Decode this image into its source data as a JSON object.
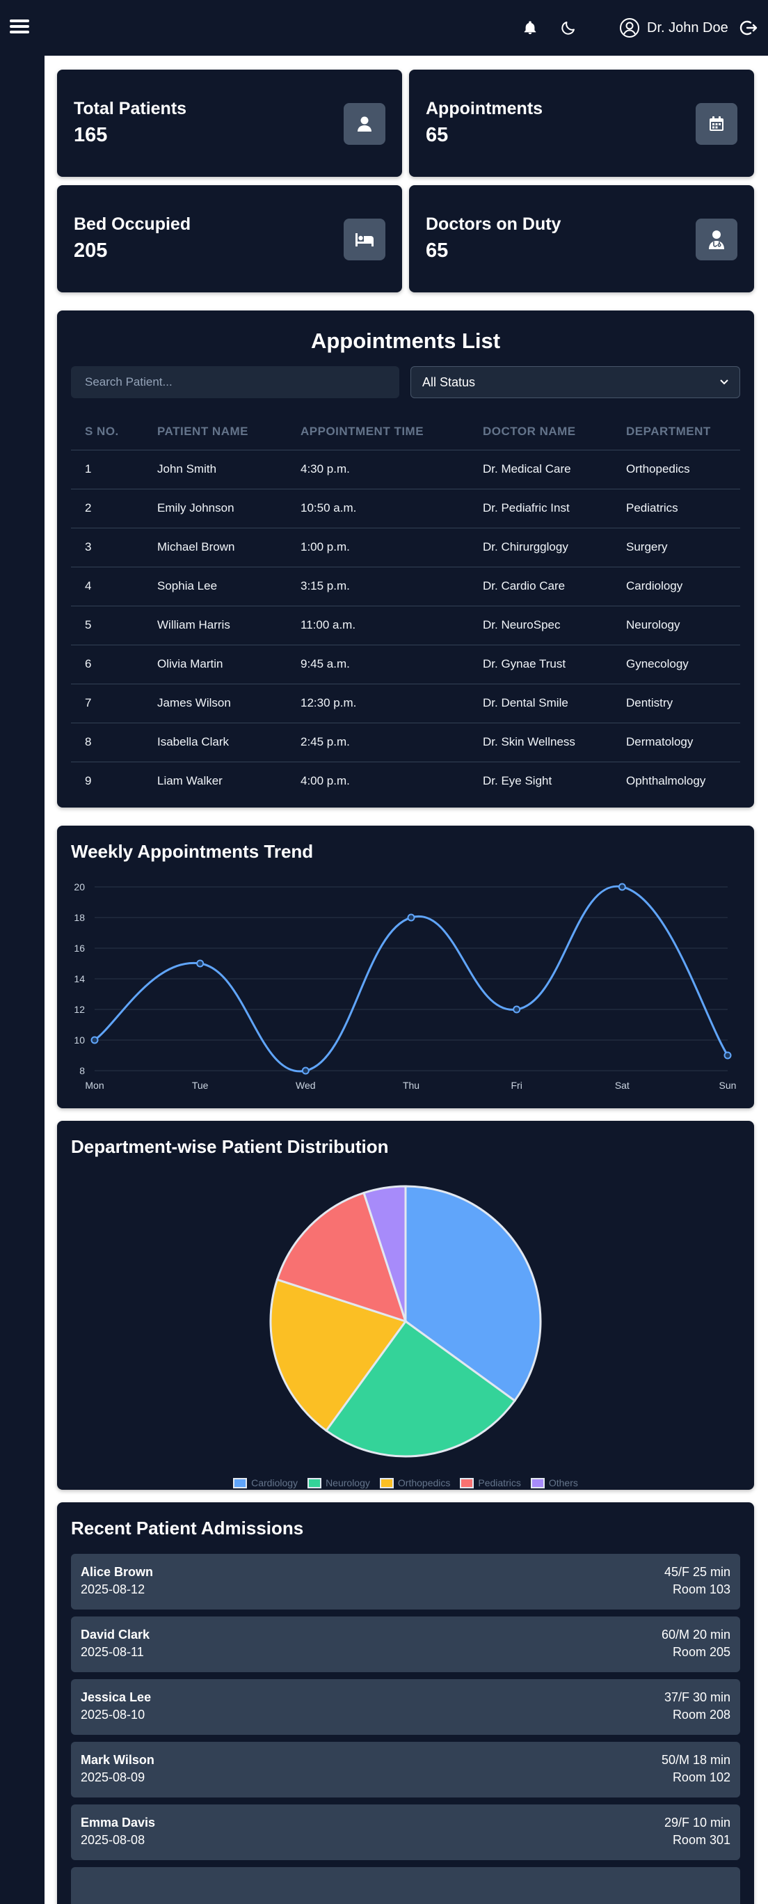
{
  "header": {
    "user_name": "Dr. John Doe",
    "icons": [
      "menu-icon",
      "bell-icon",
      "moon-icon",
      "user-circle-icon",
      "logout-icon"
    ]
  },
  "stats": [
    {
      "label": "Total Patients",
      "value": "165",
      "icon": "user-icon"
    },
    {
      "label": "Appointments",
      "value": "65",
      "icon": "calendar-icon"
    },
    {
      "label": "Bed Occupied",
      "value": "205",
      "icon": "bed-icon"
    },
    {
      "label": "Doctors on Duty",
      "value": "65",
      "icon": "doctor-icon"
    }
  ],
  "appointments": {
    "title": "Appointments List",
    "search_placeholder": "Search Patient...",
    "status_filter": "All Status",
    "columns": [
      "S NO.",
      "PATIENT NAME",
      "APPOINTMENT TIME",
      "DOCTOR NAME",
      "DEPARTMENT"
    ],
    "rows": [
      [
        "1",
        "John Smith",
        "4:30 p.m.",
        "Dr. Medical Care",
        "Orthopedics"
      ],
      [
        "2",
        "Emily Johnson",
        "10:50 a.m.",
        "Dr. Pediafric Inst",
        "Pediatrics"
      ],
      [
        "3",
        "Michael Brown",
        "1:00 p.m.",
        "Dr. Chirurgglogy",
        "Surgery"
      ],
      [
        "4",
        "Sophia Lee",
        "3:15 p.m.",
        "Dr. Cardio Care",
        "Cardiology"
      ],
      [
        "5",
        "William Harris",
        "11:00 a.m.",
        "Dr. NeuroSpec",
        "Neurology"
      ],
      [
        "6",
        "Olivia Martin",
        "9:45 a.m.",
        "Dr. Gynae Trust",
        "Gynecology"
      ],
      [
        "7",
        "James Wilson",
        "12:30 p.m.",
        "Dr. Dental Smile",
        "Dentistry"
      ],
      [
        "8",
        "Isabella Clark",
        "2:45 p.m.",
        "Dr. Skin Wellness",
        "Dermatology"
      ],
      [
        "9",
        "Liam Walker",
        "4:00 p.m.",
        "Dr. Eye Sight",
        "Ophthalmology"
      ]
    ]
  },
  "weekly_trend": {
    "title": "Weekly Appointments Trend",
    "chart_data": {
      "type": "line",
      "x": [
        "Mon",
        "Tue",
        "Wed",
        "Thu",
        "Fri",
        "Sat",
        "Sun"
      ],
      "series": [
        {
          "values": [
            10,
            15,
            8,
            18,
            12,
            20,
            9
          ],
          "color": "#60a5fa"
        }
      ],
      "yticks": [
        8,
        10,
        12,
        14,
        16,
        18,
        20
      ],
      "ylim": [
        8,
        20
      ],
      "grid": true
    }
  },
  "department_distribution": {
    "title": "Department-wise Patient Distribution",
    "chart_data": {
      "type": "pie",
      "labels": [
        "Cardiology",
        "Neurology",
        "Orthopedics",
        "Pediatrics",
        "Others"
      ],
      "values": [
        35,
        25,
        20,
        15,
        5
      ],
      "colors": [
        "#60a5fa",
        "#34d399",
        "#fbbf24",
        "#f87171",
        "#a78bfa"
      ],
      "legend": "bottom"
    }
  },
  "admissions": {
    "title": "Recent Patient Admissions",
    "items": [
      {
        "name": "Alice Brown",
        "date": "2025-08-12",
        "info": "45/F 25 min",
        "room": "Room 103"
      },
      {
        "name": "David Clark",
        "date": "2025-08-11",
        "info": "60/M 20 min",
        "room": "Room 205"
      },
      {
        "name": "Jessica Lee",
        "date": "2025-08-10",
        "info": "37/F 30 min",
        "room": "Room 208"
      },
      {
        "name": "Mark Wilson",
        "date": "2025-08-09",
        "info": "50/M 18 min",
        "room": "Room 102"
      },
      {
        "name": "Emma Davis",
        "date": "2025-08-08",
        "info": "29/F 10 min",
        "room": "Room 301"
      }
    ]
  }
}
